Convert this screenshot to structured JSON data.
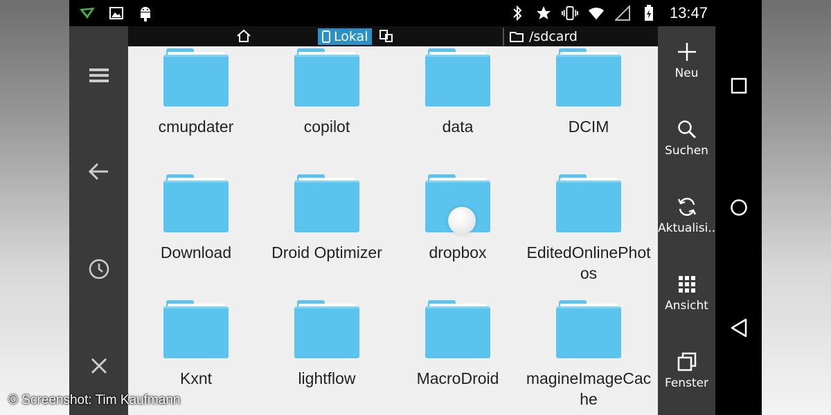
{
  "status_bar": {
    "time": "13:47",
    "icons_left": [
      "notification-arrow-icon",
      "image-icon",
      "android-icon"
    ],
    "icons_right": [
      "bluetooth-icon",
      "star-icon",
      "vibrate-icon",
      "wifi-icon",
      "signal-icon",
      "battery-icon"
    ]
  },
  "path_bar": {
    "home_icon": "home-icon",
    "location_label": "Lokal",
    "device_icon": "devices-icon",
    "path": "/sdcard"
  },
  "left_rail": {
    "items": [
      "menu-icon",
      "back-arrow-icon",
      "history-icon",
      "close-icon"
    ]
  },
  "folders": [
    {
      "name": "cmupdater"
    },
    {
      "name": "copilot"
    },
    {
      "name": "data"
    },
    {
      "name": "DCIM"
    },
    {
      "name": "Download"
    },
    {
      "name": "Droid Optimizer"
    },
    {
      "name": "dropbox"
    },
    {
      "name": "EditedOnlinePhotos"
    },
    {
      "name": "Kxnt"
    },
    {
      "name": "lightflow"
    },
    {
      "name": "MacroDroid"
    },
    {
      "name": "magineImageCache"
    }
  ],
  "right_rail": {
    "items": [
      {
        "label": "Neu",
        "icon": "plus-icon"
      },
      {
        "label": "Suchen",
        "icon": "search-icon"
      },
      {
        "label": "Aktualisi...",
        "icon": "refresh-icon"
      },
      {
        "label": "Ansicht",
        "icon": "grid-icon"
      },
      {
        "label": "Fenster",
        "icon": "windows-icon"
      }
    ]
  },
  "nav_bar": {
    "items": [
      "recents-icon",
      "home-circle-icon",
      "back-triangle-icon"
    ]
  },
  "credit": "© Screenshot: Tim Kaufmann",
  "colors": {
    "folder": "#5ac4ee",
    "selected_location": "#2a90c8",
    "rail_background": "#3a3a3a",
    "content_background": "#efefef"
  }
}
